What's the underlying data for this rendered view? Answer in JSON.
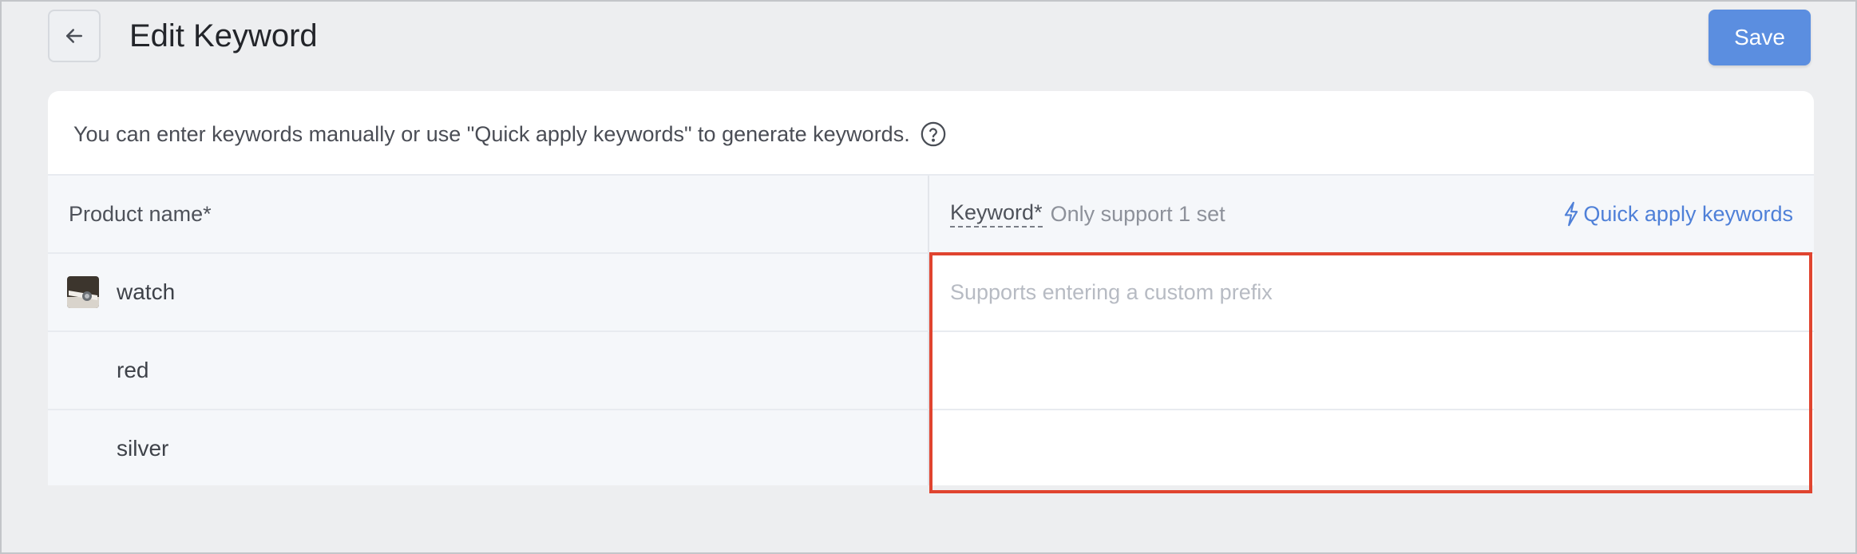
{
  "header": {
    "title": "Edit Keyword",
    "save_label": "Save",
    "back_icon": "arrow-left-icon"
  },
  "info": {
    "text": "You can enter keywords manually or use \"Quick apply keywords\" to generate keywords.",
    "help_icon": "question-circle-icon"
  },
  "table": {
    "columns": {
      "product": "Product name*",
      "keyword": "Keyword*",
      "keyword_note": "Only support 1 set",
      "quick_apply": "Quick apply keywords",
      "quick_apply_icon": "lightning-bolt-icon"
    },
    "rows": [
      {
        "product": "watch",
        "keyword": "",
        "placeholder": "Supports entering a custom prefix",
        "has_thumbnail": true
      },
      {
        "product": "red",
        "keyword": "",
        "placeholder": "",
        "has_thumbnail": false
      },
      {
        "product": "silver",
        "keyword": "",
        "placeholder": "",
        "has_thumbnail": false
      }
    ]
  },
  "colors": {
    "accent": "#5b8ee0",
    "link": "#4f80d8",
    "highlight": "#e0442f",
    "background": "#edeef0"
  }
}
